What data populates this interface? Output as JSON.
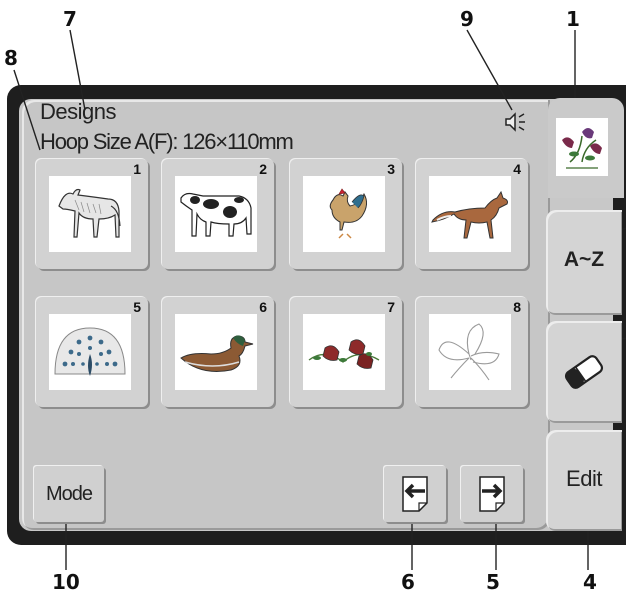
{
  "screen": {
    "title": "Designs",
    "hoop_size": "Hoop Size A(F): 126×110mm",
    "sound_icon": "speaker-icon"
  },
  "designs": [
    {
      "number": "1",
      "icon": "horse-design-icon"
    },
    {
      "number": "2",
      "icon": "cow-design-icon"
    },
    {
      "number": "3",
      "icon": "rooster-design-icon"
    },
    {
      "number": "4",
      "icon": "fox-design-icon"
    },
    {
      "number": "5",
      "icon": "peacock-design-icon"
    },
    {
      "number": "6",
      "icon": "duck-design-icon"
    },
    {
      "number": "7",
      "icon": "bells-design-icon"
    },
    {
      "number": "8",
      "icon": "butterfly-design-icon"
    }
  ],
  "buttons": {
    "mode": "Mode",
    "prev_icon": "page-back-arrow-icon",
    "next_icon": "page-forward-arrow-icon"
  },
  "tabs": {
    "designs_icon": "floral-design-icon",
    "az": "A~Z",
    "erase_icon": "eraser-icon",
    "edit": "Edit"
  },
  "callouts": [
    "1",
    "4",
    "5",
    "6",
    "7",
    "8",
    "9",
    "10"
  ],
  "colors": {
    "panel": "#c6c6c6",
    "button": "#d0d0d0",
    "bezel": "#1e1e1e",
    "thumb_bg": "#ffffff"
  }
}
